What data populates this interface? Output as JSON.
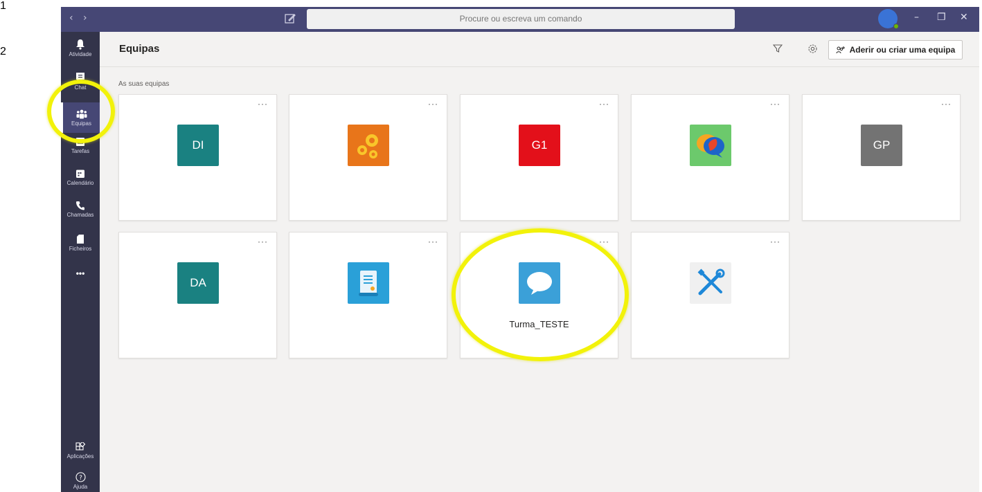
{
  "titlebar": {
    "back_icon": "‹",
    "forward_icon": "›",
    "search_placeholder": "Procure ou escreva um comando",
    "minimize_icon": "–",
    "maximize_icon": "❐",
    "close_icon": "✕"
  },
  "rail": {
    "items": [
      {
        "label": "Atividade",
        "icon": "bell-icon"
      },
      {
        "label": "Chat",
        "icon": "chat-icon"
      },
      {
        "label": "Equipas",
        "icon": "teams-icon"
      },
      {
        "label": "Tarefas",
        "icon": "tasks-icon"
      },
      {
        "label": "Calendário",
        "icon": "calendar-icon"
      },
      {
        "label": "Chamadas",
        "icon": "phone-icon"
      },
      {
        "label": "Ficheiros",
        "icon": "file-icon"
      }
    ],
    "more": "•••",
    "apps_label": "Aplicações",
    "help_label": "Ajuda"
  },
  "header": {
    "title": "Equipas",
    "join_button": "Aderir ou criar uma equipa"
  },
  "section_label": "As suas equipas",
  "teams": [
    {
      "initials": "DI",
      "color": "#1a8181",
      "name": ""
    },
    {
      "initials": "",
      "icon": "gears-icon",
      "color": "#e8751a",
      "name": ""
    },
    {
      "initials": "G1",
      "color": "#e3101a",
      "name": ""
    },
    {
      "initials": "",
      "icon": "speech-bubbles-icon",
      "color": "#6cc96c",
      "name": ""
    },
    {
      "initials": "GP",
      "color": "#737373",
      "name": ""
    },
    {
      "initials": "DA",
      "color": "#1a8181",
      "name": ""
    },
    {
      "initials": "",
      "icon": "document-scroll-icon",
      "color": "#2aa0d8",
      "name": ""
    },
    {
      "initials": "",
      "icon": "chat-bubble-icon",
      "color": "#3ba0d8",
      "name": "Turma_TESTE"
    },
    {
      "initials": "",
      "icon": "wrench-screwdriver-icon",
      "color": "#f0f0f0",
      "name": ""
    }
  ],
  "card_more": "···",
  "annotations": {
    "label_1": "1",
    "label_2": "2",
    "highlight_color": "#f2f20a"
  }
}
